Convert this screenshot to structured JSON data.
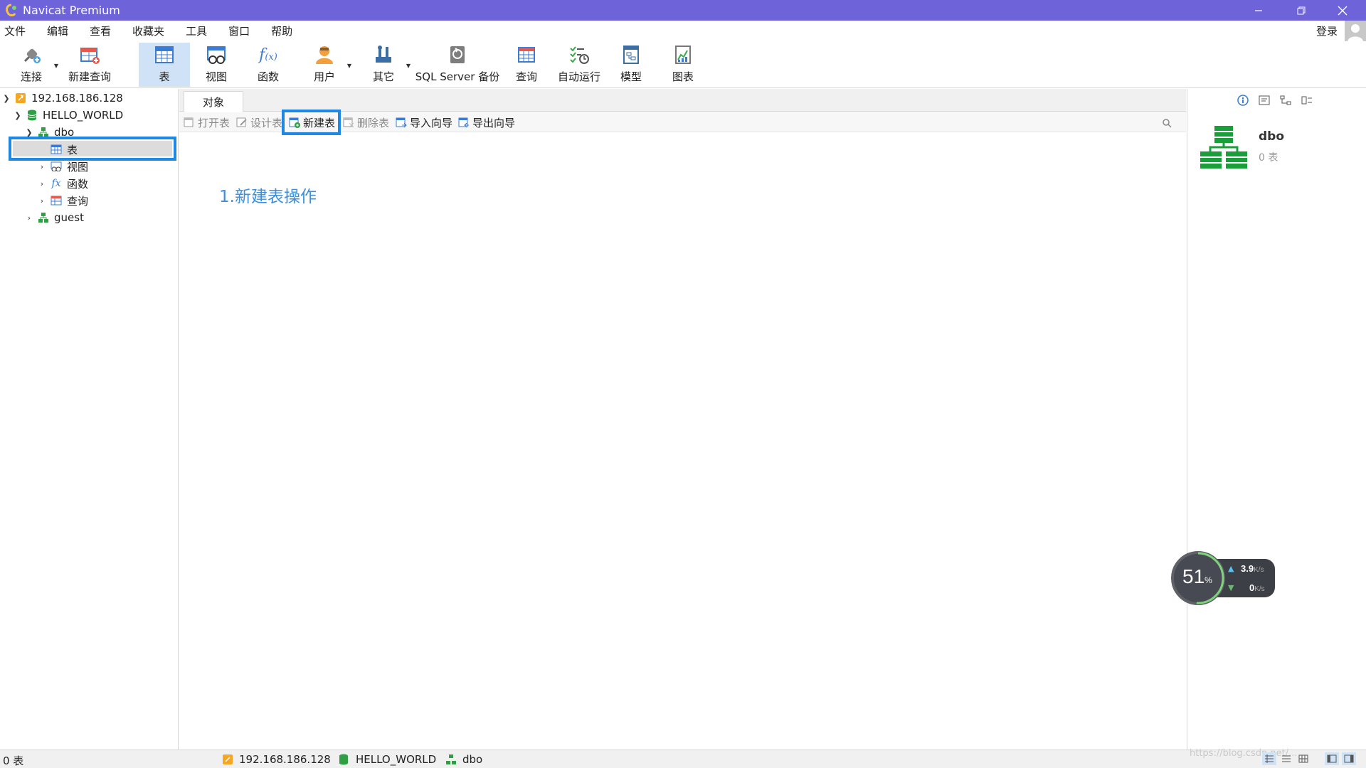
{
  "window": {
    "title": "Navicat Premium"
  },
  "menu": [
    "文件",
    "编辑",
    "查看",
    "收藏夹",
    "工具",
    "窗口",
    "帮助"
  ],
  "login_label": "登录",
  "toolbar": {
    "connect": "连接",
    "new_query": "新建查询",
    "table": "表",
    "view": "视图",
    "function": "函数",
    "user": "用户",
    "other": "其它",
    "backup": "SQL Server 备份",
    "query": "查询",
    "autorun": "自动运行",
    "model": "模型",
    "chart": "图表"
  },
  "tree": {
    "server": "192.168.186.128",
    "database": "HELLO_WORLD",
    "schema": "dbo",
    "tables": "表",
    "views": "视图",
    "functions": "函数",
    "queries": "查询",
    "guest": "guest"
  },
  "tab": {
    "objects": "对象"
  },
  "objbar": {
    "open": "打开表",
    "design": "设计表",
    "new": "新建表",
    "delete": "删除表",
    "import": "导入向导",
    "export": "导出向导"
  },
  "annotation": "1.新建表操作",
  "right_panel": {
    "name": "dbo",
    "count": "0 表"
  },
  "speed_widget": {
    "percent": "51",
    "percent_unit": "%",
    "up": "3.9",
    "down": "0",
    "unit": "K/s"
  },
  "status": {
    "count": "0 表",
    "server": "192.168.186.128",
    "database": "HELLO_WORLD",
    "schema": "dbo",
    "watermark": "https://blog.csdn.net/..."
  },
  "colors": {
    "titlebar": "#6e63d8",
    "selection_box": "#1e88e5",
    "annotation": "#3b8fdc",
    "toolbar_active": "#cfe2f6"
  }
}
